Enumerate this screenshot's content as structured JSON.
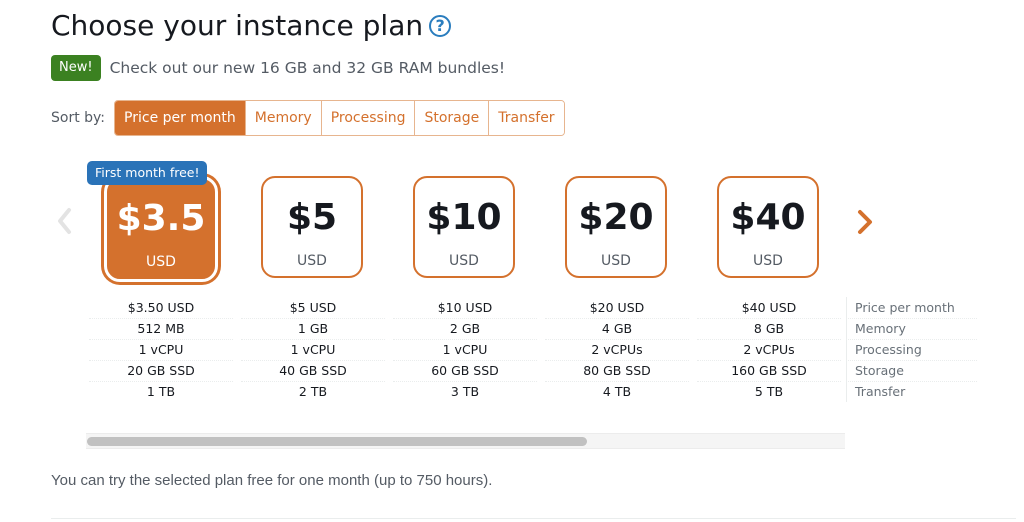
{
  "header": {
    "title": "Choose your instance plan",
    "help_icon": "question-circle-icon"
  },
  "promo": {
    "badge": "New!",
    "text": "Check out our new 16 GB and 32 GB RAM bundles!"
  },
  "sort": {
    "label": "Sort by:",
    "options": [
      "Price per month",
      "Memory",
      "Processing",
      "Storage",
      "Transfer"
    ],
    "selected": "Price per month"
  },
  "carousel": {
    "prev_icon": "chevron-left-icon",
    "next_icon": "chevron-right-icon",
    "scroll_position_fraction": 0.66
  },
  "plans": [
    {
      "price": "$3.5",
      "currency": "USD",
      "selected": true,
      "badge": "First month free!",
      "specs": [
        "$3.50 USD",
        "512 MB",
        "1 vCPU",
        "20 GB SSD",
        "1 TB"
      ]
    },
    {
      "price": "$5",
      "currency": "USD",
      "selected": false,
      "specs": [
        "$5 USD",
        "1 GB",
        "1 vCPU",
        "40 GB SSD",
        "2 TB"
      ]
    },
    {
      "price": "$10",
      "currency": "USD",
      "selected": false,
      "specs": [
        "$10 USD",
        "2 GB",
        "1 vCPU",
        "60 GB SSD",
        "3 TB"
      ]
    },
    {
      "price": "$20",
      "currency": "USD",
      "selected": false,
      "specs": [
        "$20 USD",
        "4 GB",
        "2 vCPUs",
        "80 GB SSD",
        "4 TB"
      ]
    },
    {
      "price": "$40",
      "currency": "USD",
      "selected": false,
      "specs": [
        "$40 USD",
        "8 GB",
        "2 vCPUs",
        "160 GB SSD",
        "5 TB"
      ]
    }
  ],
  "spec_labels": [
    "Price per month",
    "Memory",
    "Processing",
    "Storage",
    "Transfer"
  ],
  "footnote": "You can try the selected plan free for one month (up to 750 hours).",
  "colors": {
    "accent": "#d4712d",
    "badge_green": "#3b8121",
    "badge_blue": "#2a73b8",
    "help_blue": "#2a7dbe"
  }
}
